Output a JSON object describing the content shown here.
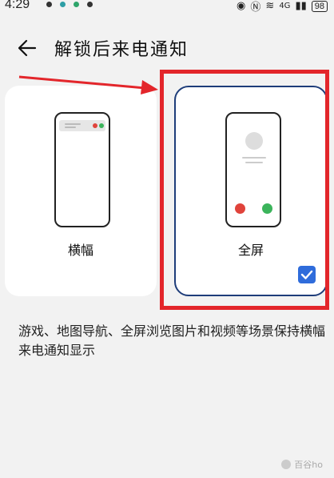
{
  "status_bar": {
    "time": "4:29",
    "battery": "98",
    "signal": "4G"
  },
  "header": {
    "back_icon": "arrow-left-icon",
    "title": "解锁后来电通知"
  },
  "options": [
    {
      "label": "横幅",
      "selected": false
    },
    {
      "label": "全屏",
      "selected": true
    }
  ],
  "description": "游戏、地图导航、全屏浏览图片和视频等场景保持横幅来电通知显示",
  "annotation_colors": {
    "highlight": "#e3262b",
    "selected_border": "#1e3d7a",
    "checkbox": "#2f6cdb",
    "decline": "#e0433b",
    "accept": "#3bb45b"
  },
  "watermark": "百谷ho"
}
